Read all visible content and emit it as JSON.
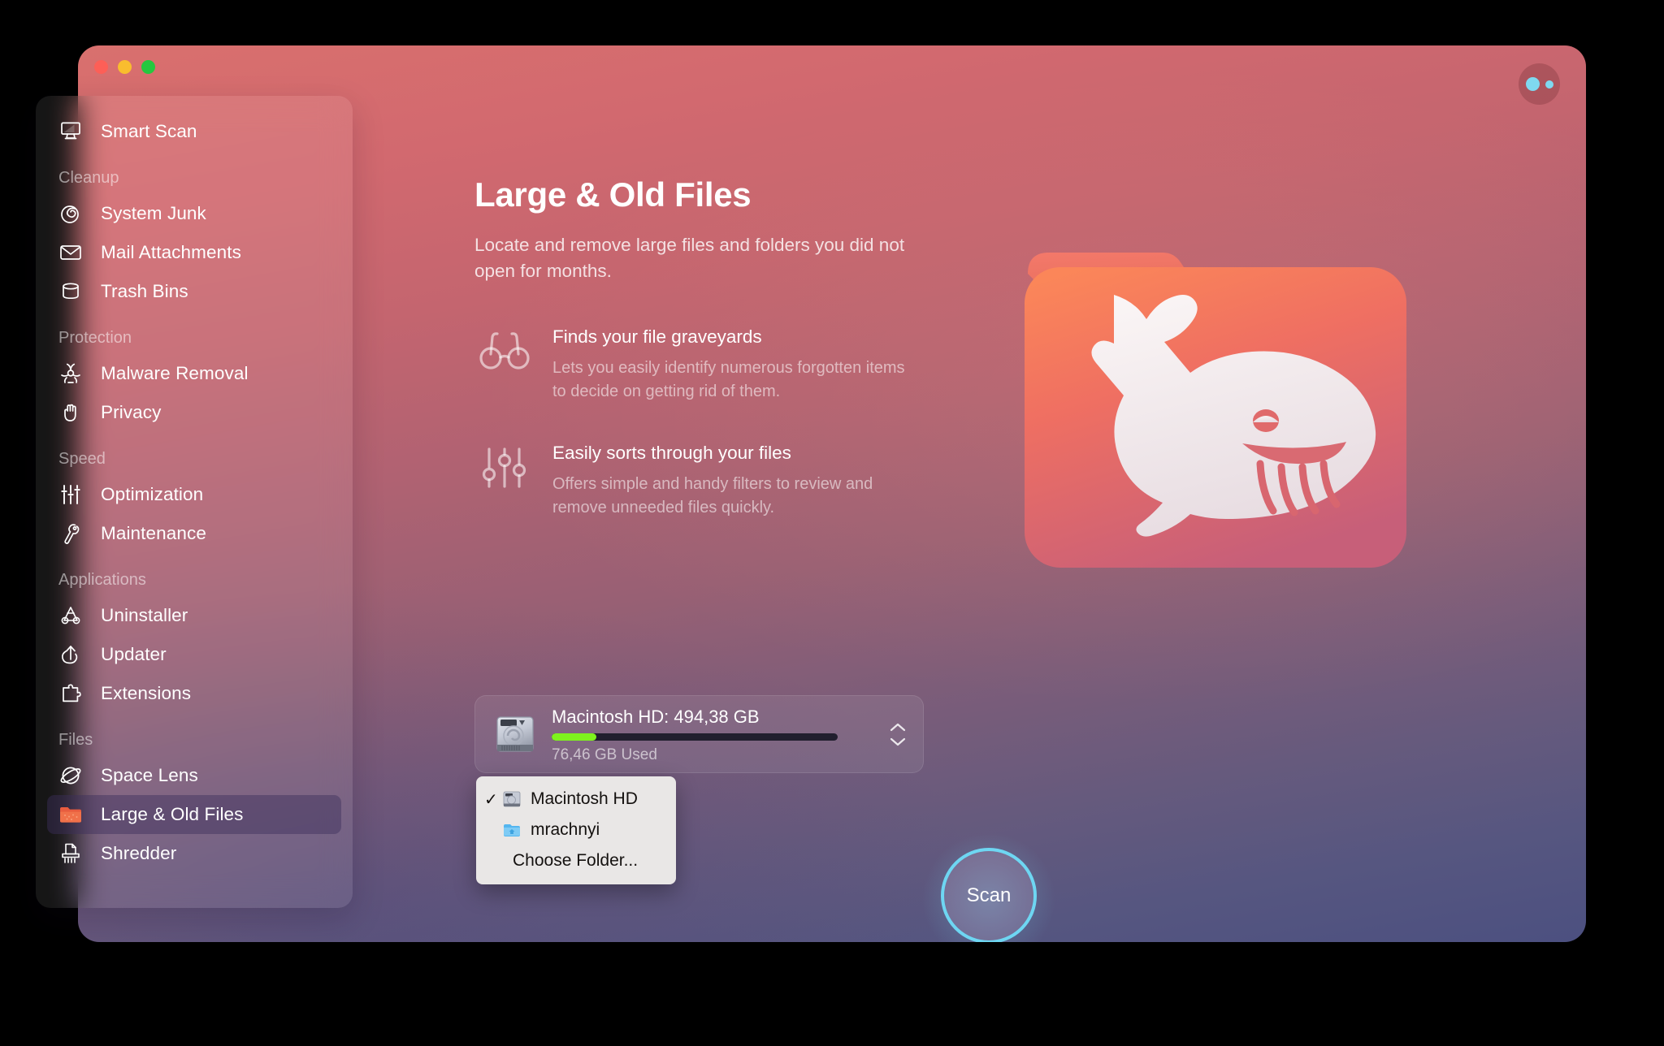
{
  "window": {
    "traffic_lights": [
      {
        "name": "close",
        "color": "#fd5f57"
      },
      {
        "name": "minimize",
        "color": "#f9bd2e"
      },
      {
        "name": "maximize",
        "color": "#25c83f"
      }
    ],
    "assistant_button": "assistant-icon"
  },
  "sidebar": {
    "items": [
      {
        "label": "Smart Scan",
        "icon": "smart-scan-icon",
        "type": "item",
        "selected": false
      },
      {
        "label": "Cleanup",
        "type": "group"
      },
      {
        "label": "System Junk",
        "icon": "system-junk-icon",
        "type": "item",
        "selected": false
      },
      {
        "label": "Mail Attachments",
        "icon": "mail-icon",
        "type": "item",
        "selected": false
      },
      {
        "label": "Trash Bins",
        "icon": "trash-icon",
        "type": "item",
        "selected": false
      },
      {
        "label": "Protection",
        "type": "group"
      },
      {
        "label": "Malware Removal",
        "icon": "biohazard-icon",
        "type": "item",
        "selected": false
      },
      {
        "label": "Privacy",
        "icon": "hand-icon",
        "type": "item",
        "selected": false
      },
      {
        "label": "Speed",
        "type": "group"
      },
      {
        "label": "Optimization",
        "icon": "sliders-icon",
        "type": "item",
        "selected": false
      },
      {
        "label": "Maintenance",
        "icon": "wrench-icon",
        "type": "item",
        "selected": false
      },
      {
        "label": "Applications",
        "type": "group"
      },
      {
        "label": "Uninstaller",
        "icon": "uninstaller-icon",
        "type": "item",
        "selected": false
      },
      {
        "label": "Updater",
        "icon": "updater-icon",
        "type": "item",
        "selected": false
      },
      {
        "label": "Extensions",
        "icon": "puzzle-icon",
        "type": "item",
        "selected": false
      },
      {
        "label": "Files",
        "type": "group"
      },
      {
        "label": "Space Lens",
        "icon": "space-lens-icon",
        "type": "item",
        "selected": false
      },
      {
        "label": "Large & Old Files",
        "icon": "folder-icon",
        "type": "item",
        "selected": true
      },
      {
        "label": "Shredder",
        "icon": "shredder-icon",
        "type": "item",
        "selected": false
      }
    ]
  },
  "main": {
    "title": "Large & Old Files",
    "description": "Locate and remove large files and folders you did not open for months.",
    "features": [
      {
        "icon": "glasses-icon",
        "title": "Finds your file graveyards",
        "subtitle": "Lets you easily identify numerous forgotten items to decide on getting rid of them."
      },
      {
        "icon": "sliders-icon",
        "title": "Easily sorts through your files",
        "subtitle": "Offers simple and handy filters to review and remove unneeded files quickly."
      }
    ],
    "hero_icon": "whale-folder-icon",
    "disk_selector": {
      "icon": "hard-disk-icon",
      "name": "Macintosh HD: 494,38 GB",
      "used": "76,46 GB Used",
      "used_percent": 15.5,
      "bar_color": "#7ef21d",
      "stepper": "stepper-icon"
    },
    "dropdown": {
      "options": [
        {
          "label": "Macintosh HD",
          "icon": "hard-disk-icon",
          "checked": true,
          "check": "✓"
        },
        {
          "label": "mrachnyi",
          "icon": "blue-folder-icon",
          "checked": false,
          "check": ""
        },
        {
          "label": "Choose Folder...",
          "icon": "",
          "checked": false,
          "check": ""
        }
      ]
    },
    "scan_button": {
      "label": "Scan",
      "accent": "#6ed6f2"
    }
  }
}
